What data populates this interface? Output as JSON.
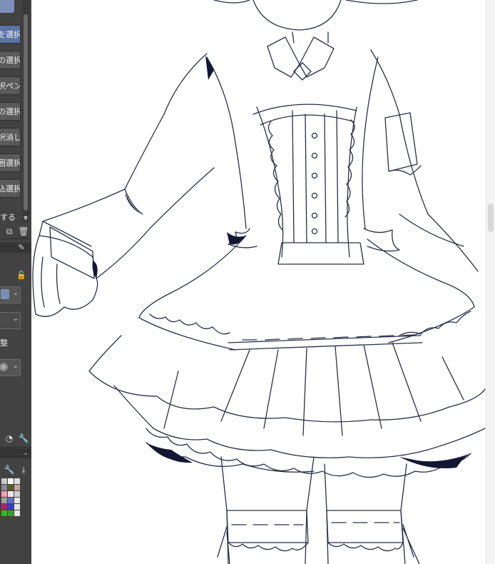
{
  "tool_panel": {
    "items": [
      {
        "label": "を選択",
        "selected": true
      },
      {
        "label": "の選択",
        "selected": false
      },
      {
        "label": "択ペン",
        "selected": false
      },
      {
        "label": "の選択",
        "selected": false
      },
      {
        "label": "択消し",
        "selected": false
      },
      {
        "label": "囲選択",
        "selected": false
      },
      {
        "label": "込選択",
        "selected": false
      }
    ],
    "footer_label": "する"
  },
  "property_panel": {
    "row_label": "整"
  },
  "colors": {
    "panel_bg": "#424242",
    "selected": "#5a74a8",
    "line_art": "#1a1f3a"
  },
  "palette": {
    "swatches": [
      "#c8c8c8",
      "#ffffff",
      "#e0e0e0",
      "#8a8a8a",
      "#5a5a2a",
      "#c8a0a0",
      "#f0a0b0",
      "#e8e8e8",
      "#d0d0d0",
      "#a0a0a0",
      "#6070c0",
      "#e8e8e8",
      "#b02070",
      "#3040c0",
      "#e8e8e8",
      "#20c020",
      "#30a030",
      "#e8e8e8"
    ]
  }
}
